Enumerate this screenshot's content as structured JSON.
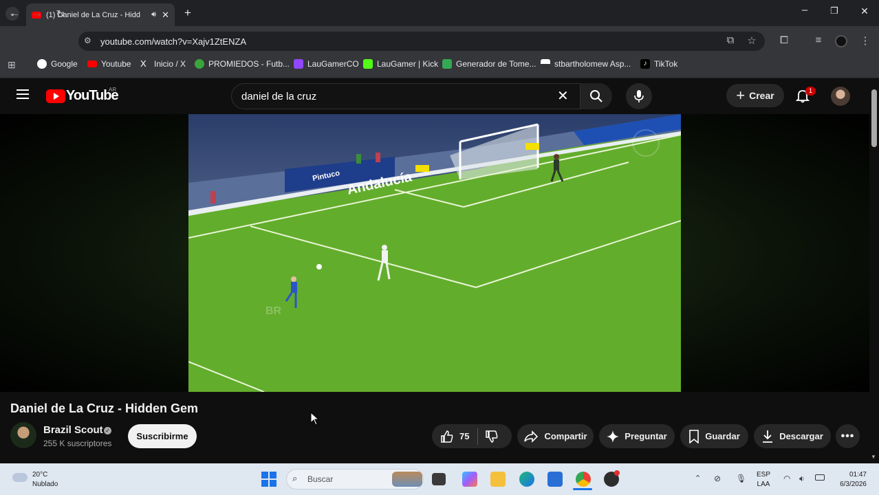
{
  "browser": {
    "tab_title": "(1) Daniel de La Cruz - Hidd",
    "url": "youtube.com/watch?v=Xajv1ZtENZA",
    "bookmarks": [
      {
        "label": "Google",
        "color": "#4285f4"
      },
      {
        "label": "Youtube",
        "color": "#ff0000"
      },
      {
        "label": "Inicio / X",
        "color": "#ffffff"
      },
      {
        "label": "PROMIEDOS - Futb...",
        "color": "#3aa53a"
      },
      {
        "label": "LauGamerCO",
        "color": "#9146ff"
      },
      {
        "label": "LauGamer | Kick",
        "color": "#53fc18"
      },
      {
        "label": "Generador de Tome...",
        "color": "#34a853"
      },
      {
        "label": "stbartholomew Asp...",
        "color": "#cccccc"
      },
      {
        "label": "TikTok",
        "color": "#000000"
      }
    ]
  },
  "youtube": {
    "logo_text": "YouTube",
    "country_code": "AR",
    "search_query": "daniel de la cruz",
    "create_label": "Crear",
    "notification_count": "1",
    "video_watermark": "BR",
    "video_ad_text": "Andalucía",
    "video_board_text": "Pintuco"
  },
  "video": {
    "title": "Daniel de La Cruz - Hidden Gem",
    "channel": "Brazil Scout",
    "subscribers": "255 K suscriptores",
    "subscribe_label": "Suscribirme",
    "likes": "75",
    "share_label": "Compartir",
    "ask_label": "Preguntar",
    "save_label": "Guardar",
    "download_label": "Descargar"
  },
  "taskbar": {
    "temperature": "20°C",
    "weather": "Nublado",
    "search_placeholder": "Buscar",
    "lang_top": "ESP",
    "lang_bottom": "LAA",
    "time": "01:47",
    "date": "6/3/2026"
  }
}
